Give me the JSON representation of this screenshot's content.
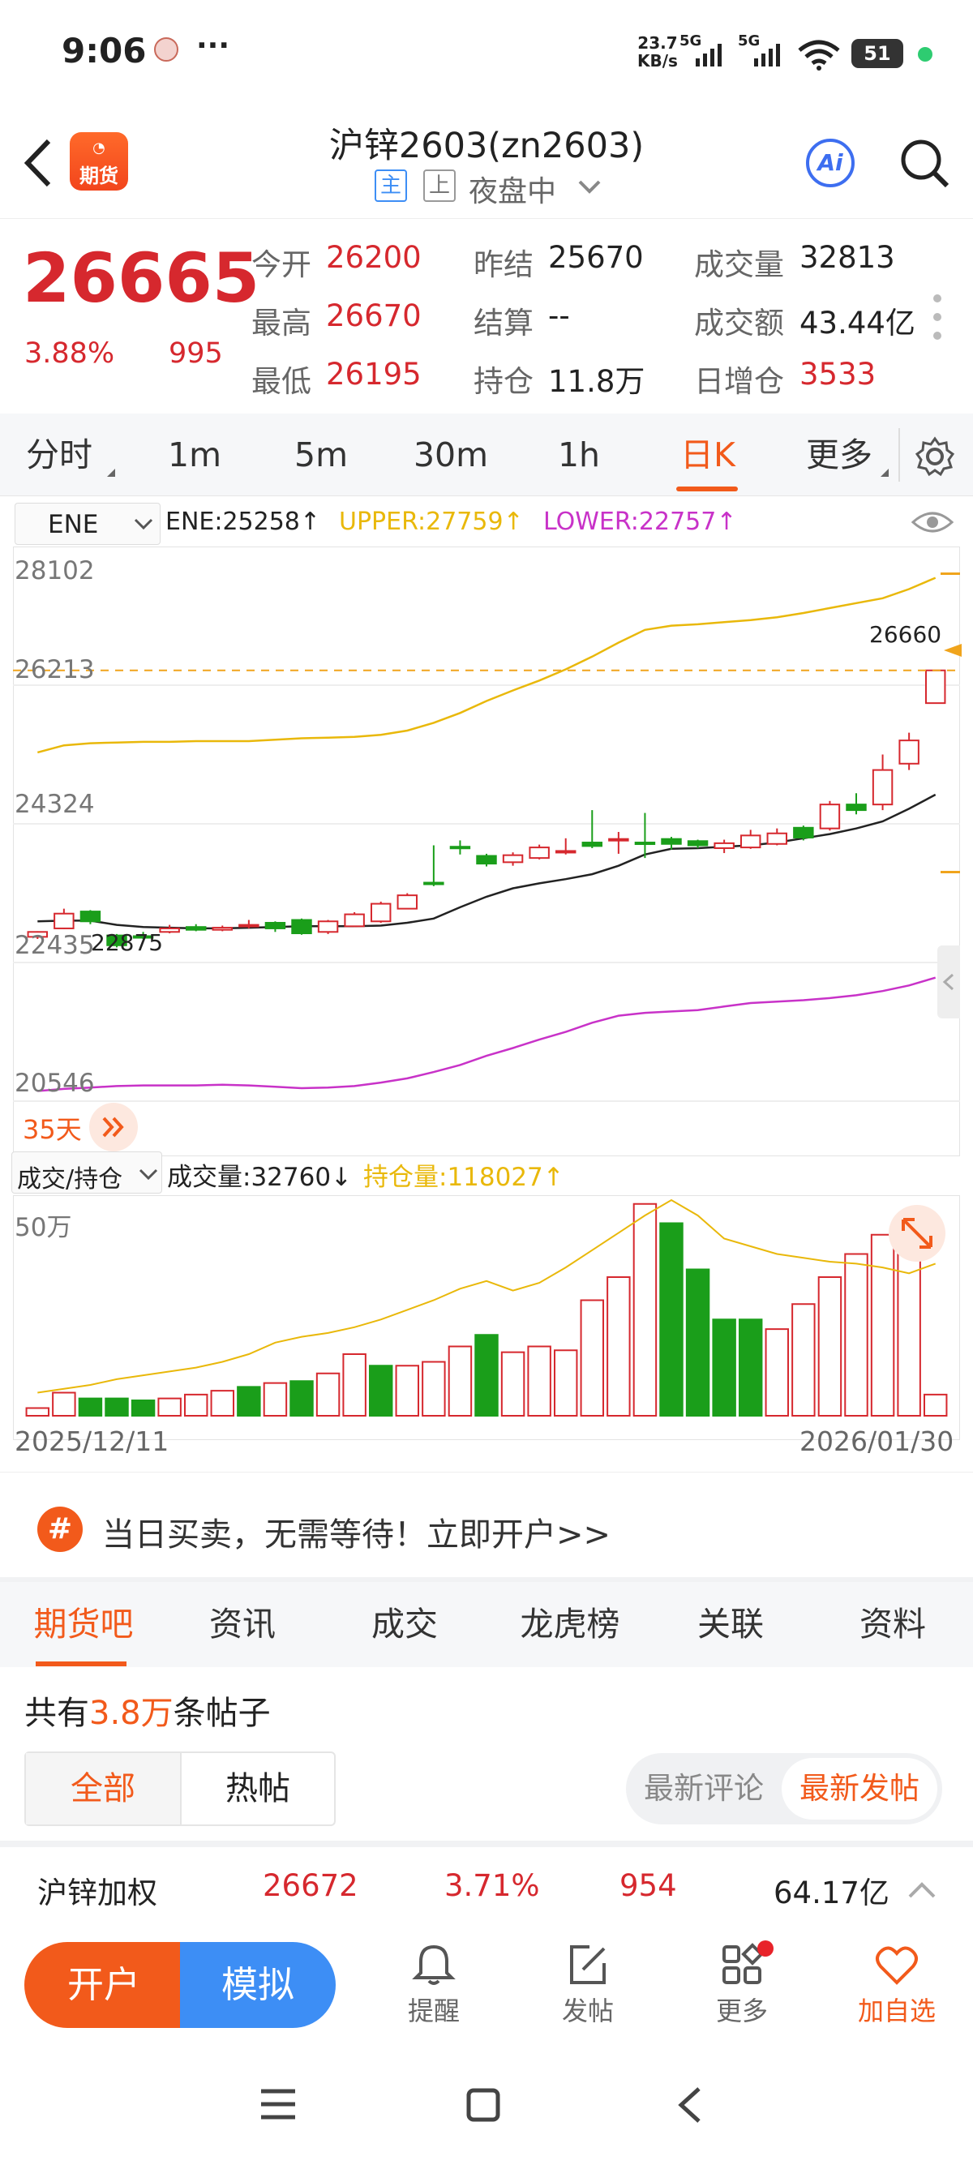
{
  "status": {
    "time": "9:06",
    "dots": "···",
    "net_speed_top": "23.7",
    "net_speed_bot": "KB/s",
    "sig1": "5G",
    "sig2": "5G",
    "wifi_sub": "6",
    "battery": "51"
  },
  "header": {
    "title": "沪锌2603(zn2603)",
    "tag_main": "主",
    "tag_exchange": "上",
    "session": "夜盘中",
    "logo_text": "期货",
    "ai_label": "Ai"
  },
  "quote": {
    "price": "26665",
    "pct": "3.88%",
    "change": "995",
    "open_label": "今开",
    "open": "26200",
    "high_label": "最高",
    "high": "26670",
    "low_label": "最低",
    "low": "26195",
    "prev_label": "昨结",
    "prev": "25670",
    "settle_label": "结算",
    "settle": "--",
    "oi_label": "持仓",
    "oi": "11.8万",
    "vol_label": "成交量",
    "vol": "32813",
    "amount_label": "成交额",
    "amount": "43.44亿",
    "daily_oi_label": "日增仓",
    "daily_oi": "3533"
  },
  "ktabs": [
    "分时",
    "1m",
    "5m",
    "30m",
    "1h",
    "日K",
    "更多"
  ],
  "indicator": {
    "name": "ENE",
    "ene": "ENE:25258↑",
    "upper": "UPPER:27759↑",
    "lower": "LOWER:22757↑"
  },
  "axis": {
    "y1": "28102",
    "y2": "26213",
    "y3": "24324",
    "y4": "22435",
    "y5": "20546",
    "last": "26660",
    "min_mark": "22875",
    "days": "35天"
  },
  "volume": {
    "selector": "成交/持仓",
    "vol": "成交量:32760↓",
    "oi": "持仓量:118027↑",
    "axis": "50万",
    "date_start": "2025/12/11",
    "date_end": "2026/01/30"
  },
  "colors": {
    "up": "#d6282e",
    "down": "#1a9e1a",
    "upper": "#e9b80a",
    "lower": "#c832c8",
    "accent": "#f25a1b",
    "blue": "#3d8ef5"
  },
  "chart_data": {
    "type": "candlestick",
    "x": [
      "2025/12/11",
      "",
      "",
      "",
      "",
      "",
      "",
      "",
      "",
      "",
      "",
      "",
      "",
      "",
      "",
      "",
      "",
      "",
      "",
      "",
      "",
      "",
      "",
      "",
      "",
      "",
      "",
      "",
      "",
      "",
      "",
      "",
      "",
      "",
      "2026/01/30"
    ],
    "open": [
      22880,
      23000,
      23240,
      22900,
      22890,
      22950,
      23020,
      22980,
      23040,
      23080,
      23120,
      22950,
      23030,
      23100,
      23280,
      23650,
      24160,
      24030,
      23940,
      24000,
      24080,
      24220,
      24250,
      24220,
      24270,
      24240,
      24140,
      24150,
      24200,
      24430,
      24420,
      24760,
      24760,
      25340,
      26200
    ],
    "close": [
      22950,
      23210,
      23100,
      22760,
      22880,
      23000,
      22980,
      23010,
      23050,
      23000,
      22930,
      23100,
      23200,
      23350,
      23470,
      23640,
      24140,
      23920,
      24040,
      24150,
      24100,
      24170,
      24270,
      24210,
      24200,
      24180,
      24210,
      24320,
      24350,
      24290,
      24760,
      24680,
      25250,
      25670,
      26665
    ],
    "high": [
      22960,
      23280,
      23260,
      22920,
      22950,
      23050,
      23060,
      23040,
      23120,
      23100,
      23140,
      23120,
      23230,
      23380,
      23500,
      24180,
      24250,
      24060,
      24080,
      24190,
      24280,
      24680,
      24370,
      24640,
      24300,
      24260,
      24260,
      24400,
      24420,
      24460,
      24810,
      24920,
      25470,
      25780,
      26670
    ],
    "low": [
      22850,
      22990,
      23060,
      22730,
      22850,
      22930,
      22960,
      22960,
      23000,
      22950,
      22910,
      22920,
      23020,
      23080,
      23270,
      23600,
      24050,
      23880,
      23890,
      23980,
      24050,
      24140,
      24060,
      24000,
      24120,
      24140,
      24070,
      24130,
      24180,
      24250,
      24390,
      24620,
      24680,
      25250,
      26195
    ],
    "ene": [
      23100,
      23110,
      23110,
      23050,
      23020,
      23010,
      23000,
      23000,
      23010,
      23020,
      23030,
      23030,
      23030,
      23040,
      23080,
      23140,
      23300,
      23450,
      23570,
      23640,
      23700,
      23770,
      23890,
      24050,
      24130,
      24140,
      24160,
      24180,
      24220,
      24280,
      24340,
      24420,
      24520,
      24700,
      24900
    ],
    "upper": [
      25500,
      25600,
      25630,
      25640,
      25650,
      25650,
      25660,
      25660,
      25660,
      25680,
      25700,
      25710,
      25720,
      25750,
      25810,
      25920,
      26060,
      26230,
      26380,
      26520,
      26680,
      26860,
      27060,
      27240,
      27300,
      27320,
      27350,
      27380,
      27420,
      27480,
      27550,
      27620,
      27690,
      27820,
      27980
    ],
    "lower": [
      20690,
      20720,
      20740,
      20760,
      20770,
      20770,
      20770,
      20780,
      20770,
      20750,
      20730,
      20740,
      20760,
      20810,
      20870,
      20960,
      21060,
      21190,
      21300,
      21420,
      21530,
      21660,
      21760,
      21800,
      21820,
      21840,
      21890,
      21940,
      21960,
      21980,
      22010,
      22050,
      22110,
      22190,
      22300
    ],
    "volume_up": [
      true,
      true,
      false,
      false,
      false,
      true,
      true,
      true,
      false,
      true,
      false,
      true,
      true,
      false,
      true,
      true,
      true,
      false,
      true,
      true,
      true,
      true,
      true,
      true,
      false,
      false,
      false,
      false,
      true,
      true,
      true,
      true,
      true,
      true,
      true
    ],
    "volume": [
      20000,
      60000,
      45000,
      45000,
      40000,
      45000,
      55000,
      65000,
      75000,
      85000,
      90000,
      110000,
      160000,
      130000,
      130000,
      140000,
      180000,
      210000,
      165000,
      180000,
      170000,
      300000,
      360000,
      550000,
      500000,
      380000,
      250000,
      250000,
      225000,
      290000,
      360000,
      420000,
      470000,
      510000,
      55000
    ],
    "oi": [
      60000,
      70000,
      80000,
      95000,
      105000,
      115000,
      125000,
      140000,
      160000,
      190000,
      205000,
      215000,
      230000,
      250000,
      275000,
      300000,
      330000,
      350000,
      325000,
      345000,
      385000,
      430000,
      475000,
      520000,
      560000,
      520000,
      460000,
      440000,
      420000,
      410000,
      400000,
      395000,
      385000,
      370000,
      395000
    ],
    "ylim": [
      20546,
      28102
    ],
    "vol_max": 560000
  },
  "banner": {
    "icon": "#",
    "text": "当日买卖，无需等待！立即开户>>"
  },
  "bottom_tabs": [
    "期货吧",
    "资讯",
    "成交",
    "龙虎榜",
    "关联",
    "资料"
  ],
  "posts": {
    "prefix": "共有",
    "count": "3.8万",
    "suffix": "条帖子",
    "filter_all": "全部",
    "filter_hot": "热帖",
    "sort_comment": "最新评论",
    "sort_post": "最新发帖"
  },
  "weighted": {
    "name": "沪锌加权",
    "price": "26672",
    "pct": "3.71%",
    "change": "954",
    "amount": "64.17亿"
  },
  "actions": {
    "open": "开户",
    "sim": "模拟",
    "alert": "提醒",
    "post": "发帖",
    "more": "更多",
    "fav": "加自选"
  }
}
